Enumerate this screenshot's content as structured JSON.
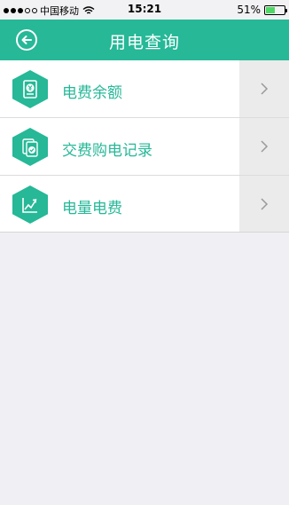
{
  "status_bar": {
    "carrier": "中国移动",
    "time": "15:21",
    "battery_percent_text": "51%",
    "battery_level": 0.51
  },
  "nav": {
    "title": "用电查询",
    "back_icon": "back-arrow-circle-icon"
  },
  "menu": {
    "items": [
      {
        "label": "电费余额",
        "icon": "balance-yuan-icon"
      },
      {
        "label": "交费购电记录",
        "icon": "payment-record-icon"
      },
      {
        "label": "电量电费",
        "icon": "usage-chart-icon"
      }
    ]
  },
  "colors": {
    "accent": "#26b897",
    "background": "#efeff4",
    "chevron_zone": "#ebebeb"
  }
}
